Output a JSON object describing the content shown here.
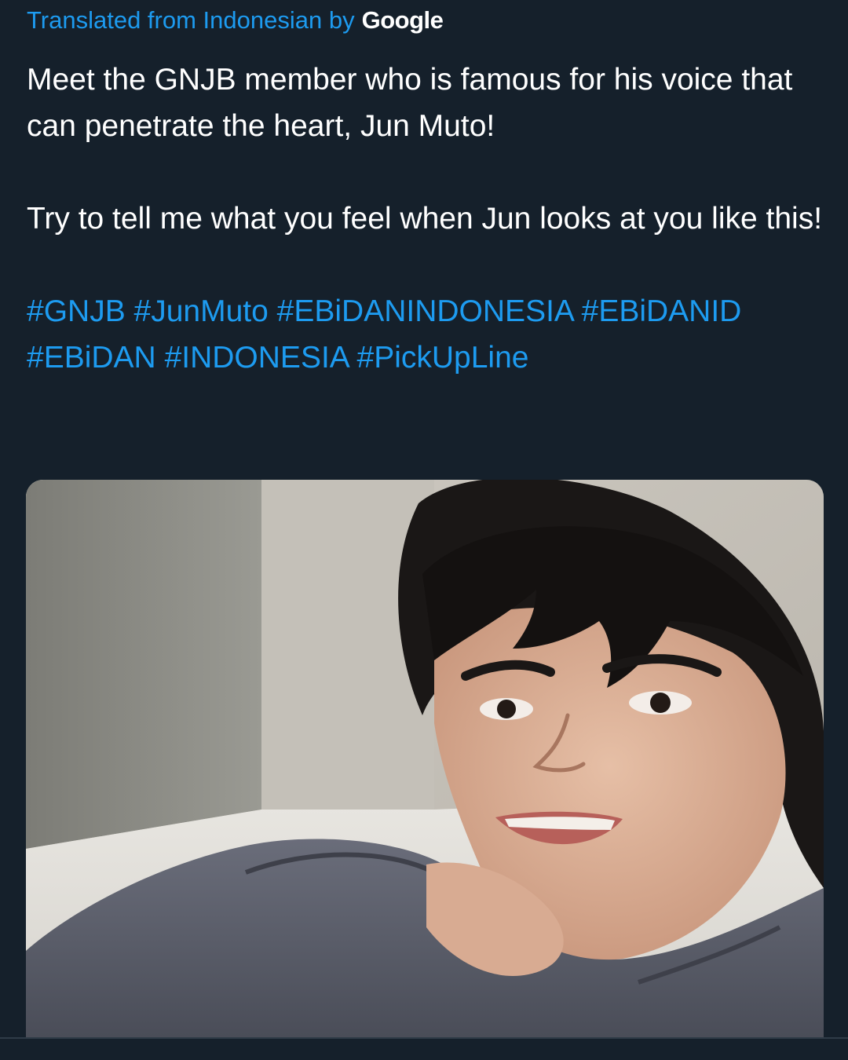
{
  "translation": {
    "prefix": "Translated from Indonesian by",
    "provider": "Google"
  },
  "tweet": {
    "paragraphs": [
      "Meet the GNJB member who is famous for his voice that can penetrate the heart, Jun Muto!",
      "Try to tell me what you feel when Jun looks at you like this!"
    ],
    "hashtags": [
      "#GNJB",
      "#JunMuto",
      "#EBiDANINDONESIA",
      "#EBiDANID",
      "#EBiDAN",
      "#INDONESIA",
      "#PickUpLine"
    ]
  },
  "colors": {
    "background": "#15202b",
    "accent": "#1d9bf0",
    "text": "#ffffff"
  }
}
